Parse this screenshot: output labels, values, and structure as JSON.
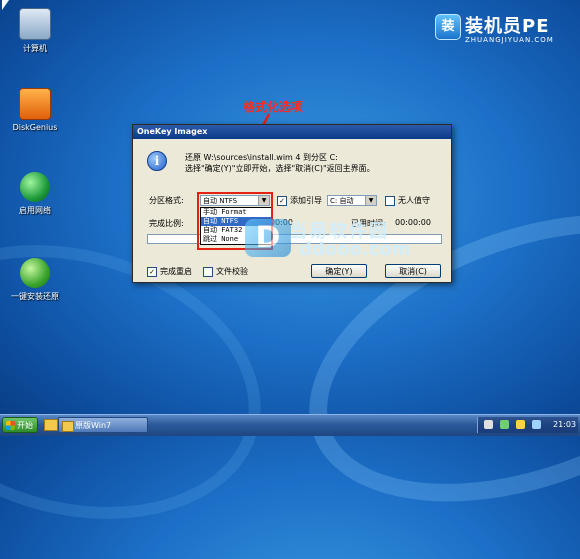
{
  "desktop": {
    "icons": [
      {
        "label": "计算机"
      },
      {
        "label": "DiskGenius"
      },
      {
        "label": "启用网络"
      },
      {
        "label": "一键安装还原"
      }
    ]
  },
  "logo": {
    "name": "装机员PE",
    "url": "ZHUANGJIYUAN.COM"
  },
  "annotation": {
    "text": "格式化选项",
    "color": "#ff2a1a"
  },
  "dialog": {
    "title": "OneKey Imagex",
    "message_line1": "还原 W:\\sources\\install.wim 4 到分区 C:",
    "message_line2": "选择\"确定(Y)\"立即开始，选择\"取消(C)\"返回主界面。",
    "format_label": "分区格式:",
    "format_value": "自动 NTFS",
    "format_options": [
      "手动 Format",
      "自动 NTFS",
      "自动 FAT32",
      "跳过 None"
    ],
    "format_selected_index": 1,
    "bootloader_label": "添加引导",
    "bootloader_checked": true,
    "bootloader_value": "C: 自动",
    "unattended_label": "无人值守",
    "unattended_checked": false,
    "progress_label": "完成比例:",
    "elapsed_label": "用时间:",
    "elapsed_value": "00:00:00",
    "used_label": "已用时间:",
    "used_value": "00:00:00",
    "progress": 0,
    "reboot_label": "完成重启",
    "reboot_checked": true,
    "verify_label": "文件校验",
    "verify_checked": false,
    "ok_label": "确定(Y)",
    "cancel_label": "取消(C)"
  },
  "watermark": {
    "cn": "当易软件园",
    "en": "ddooo.com",
    "mark": "D"
  },
  "taskbar": {
    "start_label": "开始",
    "window_label": "原版Win7",
    "clock": "21:03"
  },
  "colors": {
    "accent": "#316ac5",
    "title_bar": "#0a3a8a",
    "annotation_red": "#e52014"
  }
}
